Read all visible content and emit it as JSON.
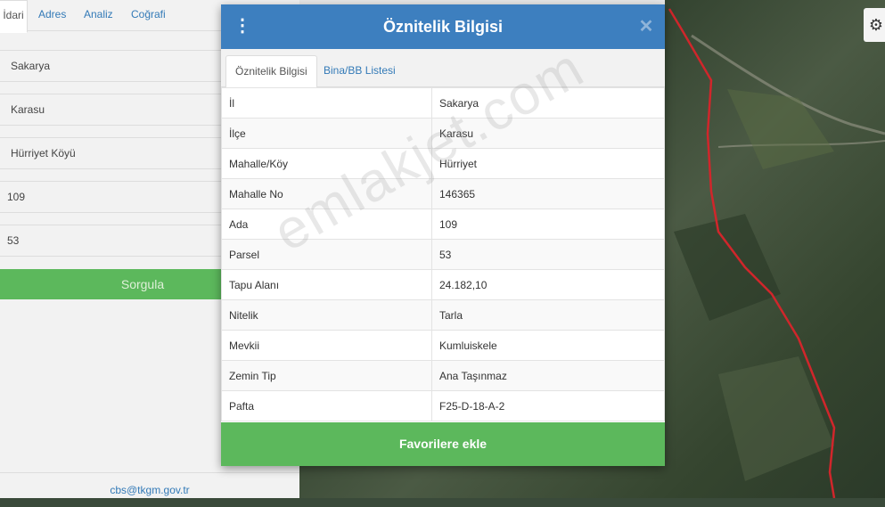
{
  "left_panel": {
    "tabs": [
      {
        "label": "İdari",
        "active": true
      },
      {
        "label": "Adres",
        "active": false
      },
      {
        "label": "Analiz",
        "active": false
      },
      {
        "label": "Coğrafi",
        "active": false
      }
    ],
    "fields": {
      "il": "Sakarya",
      "ilce": "Karasu",
      "mahalle": "Hürriyet Köyü",
      "ada": "109",
      "parsel": "53"
    },
    "query_button": "Sorgula",
    "footer_email": "cbs@tkgm.gov.tr"
  },
  "dialog": {
    "title": "Öznitelik Bilgisi",
    "tabs": [
      {
        "label": "Öznitelik Bilgisi",
        "active": true
      },
      {
        "label": "Bina/BB Listesi",
        "active": false
      }
    ],
    "rows": [
      {
        "key": "İl",
        "value": "Sakarya"
      },
      {
        "key": "İlçe",
        "value": "Karasu"
      },
      {
        "key": "Mahalle/Köy",
        "value": "Hürriyet"
      },
      {
        "key": "Mahalle No",
        "value": "146365"
      },
      {
        "key": "Ada",
        "value": "109"
      },
      {
        "key": "Parsel",
        "value": "53"
      },
      {
        "key": "Tapu Alanı",
        "value": "24.182,10"
      },
      {
        "key": "Nitelik",
        "value": "Tarla"
      },
      {
        "key": "Mevkii",
        "value": "Kumluiskele"
      },
      {
        "key": "Zemin Tip",
        "value": "Ana Taşınmaz"
      },
      {
        "key": "Pafta",
        "value": "F25-D-18-A-2"
      }
    ],
    "favorite_button": "Favorilere ekle"
  },
  "watermark": "emlakjet.com",
  "icons": {
    "menu": "kebab-menu-icon",
    "close": "close-icon",
    "settings": "gear-icon"
  },
  "colors": {
    "header_blue": "#3d7fbf",
    "green_button": "#5cb85c",
    "parcel_line": "#d0262b"
  }
}
